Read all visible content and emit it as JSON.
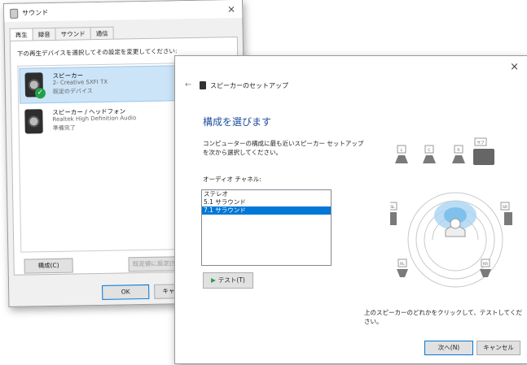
{
  "sound_window": {
    "title": "サウンド",
    "close": "×",
    "tabs": [
      "再生",
      "録音",
      "サウンド",
      "通信"
    ],
    "instruction": "下の再生デバイスを選択してその設定を変更してください:",
    "devices": [
      {
        "name": "スピーカー",
        "sub": "2- Creative SXFI TX",
        "status": "既定のデバイス",
        "selected": true,
        "default": true
      },
      {
        "name": "スピーカー / ヘッドフォン",
        "sub": "Realtek High Definition Audio",
        "status": "準備完了",
        "selected": false,
        "default": false
      }
    ],
    "configure_btn": "構成(C)",
    "set_default_btn": "既定値に設定(S)",
    "ok_btn": "OK",
    "cancel_btn": "キャンセル"
  },
  "setup_dialog": {
    "close": "×",
    "back": "←",
    "title": "スピーカーのセットアップ",
    "heading": "構成を選びます",
    "description": "コンピューターの構成に最も近いスピーカー セットアップを次から選択してください。",
    "channel_label": "オーディオ チャネル:",
    "channels": [
      "ステレオ",
      "5.1 サラウンド",
      "7.1 サラウンド"
    ],
    "selected_channel": 2,
    "test_btn": "テスト(T)",
    "footnote": "上のスピーカーのどれかをクリックして、テストしてください。",
    "next_btn": "次へ(N)",
    "cancel_btn": "キャンセル",
    "speaker_labels": [
      "L",
      "C",
      "R",
      "サブ",
      "SL",
      "SR",
      "RL",
      "RR"
    ]
  }
}
